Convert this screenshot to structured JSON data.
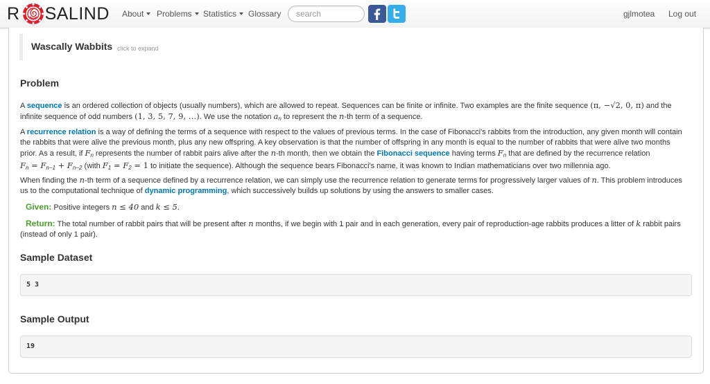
{
  "navbar": {
    "brand_r": "R",
    "brand_rest": "SALIND",
    "menu": [
      "About",
      "Problems",
      "Statistics",
      "Glossary"
    ],
    "search_placeholder": "search",
    "user": "gjlmotea",
    "logout": "Log out"
  },
  "problem": {
    "title": "Wascally Wabbits",
    "expand_hint": "click to expand",
    "section_problem": "Problem",
    "p1": {
      "a": "A ",
      "link1": "sequence",
      "b": " is an ordered collection of objects (usually numbers), which are allowed to repeat. Sequences can be finite or infinite. Two examples are the finite sequence ",
      "m1": "(π, −√2, 0, π)",
      "c": " and the",
      "d": "infinite sequence of odd numbers ",
      "m2": "(1, 3, 5, 7, 9, …)",
      "e": ". We use the notation ",
      "m3": "a",
      "m3sub": "n",
      "f": " to represent the ",
      "m4": "n",
      "g": "-th term of a sequence."
    },
    "p2": {
      "a": "A ",
      "link": "recurrence relation",
      "b": " is a way of defining the terms of a sequence with respect to the values of previous terms. In the case of Fibonacci's rabbits from the introduction, any given month will contain",
      "c": "the rabbits that were alive the previous month, plus any new offspring. A key observation is that the number of offspring in any month is equal to the number of rabbits that were alive two months",
      "d": "prior. As a result, if ",
      "m1": "F",
      "m1sub": "n",
      "e": " represents the number of rabbit pairs alive after the ",
      "m2": "n",
      "f": "-th month, then we obtain the ",
      "link2": "Fibonacci sequence",
      "g": " having terms ",
      "m3": "F",
      "m3sub": "n",
      "h": " that are defined by the recurrence relation",
      "eq": "F",
      "eq_rest": " = F",
      "eq_sub1": "n−1",
      "eq_plus": " + F",
      "eq_sub2": "n−2",
      "i": " (with ",
      "init": "F",
      "init_rest": " = F",
      "init_tail": " = 1",
      "j": " to initiate the sequence). Although the sequence bears Fibonacci's name, it was known to Indian mathematicians over two millennia ago."
    },
    "p3": {
      "a": "When finding the ",
      "m1": "n",
      "b": "-th term of a sequence defined by a recurrence relation, we can simply use the recurrence relation to generate terms for progressively larger values of ",
      "m2": "n",
      "c": ". This problem introduces",
      "d": "us to the computational technique of ",
      "link": "dynamic programming",
      "e": ", which successively builds up solutions by using the answers to smaller cases."
    },
    "given": {
      "label": "Given:",
      "text1": " Positive integers ",
      "m1": "n ≤ 40",
      "text2": " and ",
      "m2": "k ≤ 5",
      "text3": "."
    },
    "return": {
      "label": "Return:",
      "text1": " The total number of rabbit pairs that will be present after ",
      "m1": "n",
      "text2": " months, if we begin with 1 pair and in each generation, every pair of reproduction-age rabbits produces a litter of ",
      "m2": "k",
      "text3": " rabbit pairs",
      "text4": "(instead of only 1 pair)."
    },
    "sample_dataset_heading": "Sample Dataset",
    "sample_dataset": "5 3",
    "sample_output_heading": "Sample Output",
    "sample_output": "19"
  },
  "colors": {
    "link": "#0077b3",
    "green": "#4aa02c",
    "facebook": "#3b5998",
    "twitter": "#33aeeb",
    "logo_red": "#d9202a"
  }
}
